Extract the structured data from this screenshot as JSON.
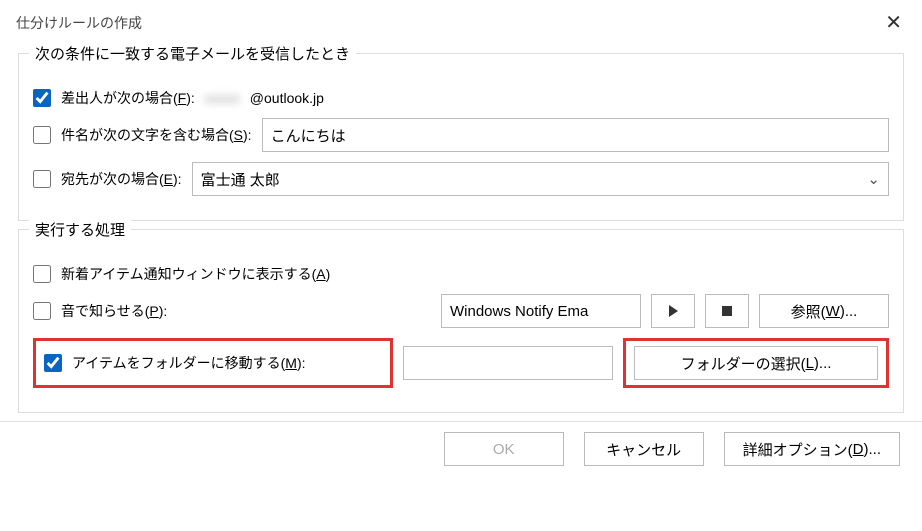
{
  "title": "仕分けルールの作成",
  "section1": {
    "legend": "次の条件に一致する電子メールを受信したとき",
    "from_label": "差出人が次の場合(",
    "from_accel": "F",
    "from_label_end": "):",
    "from_value": "@outlook.jp",
    "subject_label": "件名が次の文字を含む場合(",
    "subject_accel": "S",
    "subject_label_end": "):",
    "subject_value": "こんにちは",
    "to_label": "宛先が次の場合(",
    "to_accel": "E",
    "to_label_end": "):",
    "to_value": "富士通 太郎"
  },
  "section2": {
    "legend": "実行する処理",
    "alert_label": "新着アイテム通知ウィンドウに表示する(",
    "alert_accel": "A",
    "alert_label_end": ")",
    "sound_label": "音で知らせる(",
    "sound_accel": "P",
    "sound_label_end": "):",
    "sound_value": "Windows Notify Ema",
    "browse_label": "参照(",
    "browse_accel": "W",
    "browse_label_end": ")...",
    "move_label": "アイテムをフォルダーに移動する(",
    "move_accel": "M",
    "move_label_end": "):",
    "folder_value": "",
    "select_folder_label": "フォルダーの選択(",
    "select_folder_accel": "L",
    "select_folder_label_end": ")..."
  },
  "buttons": {
    "ok": "OK",
    "cancel": "キャンセル",
    "advanced": "詳細オプション(",
    "advanced_accel": "D",
    "advanced_end": ")..."
  }
}
